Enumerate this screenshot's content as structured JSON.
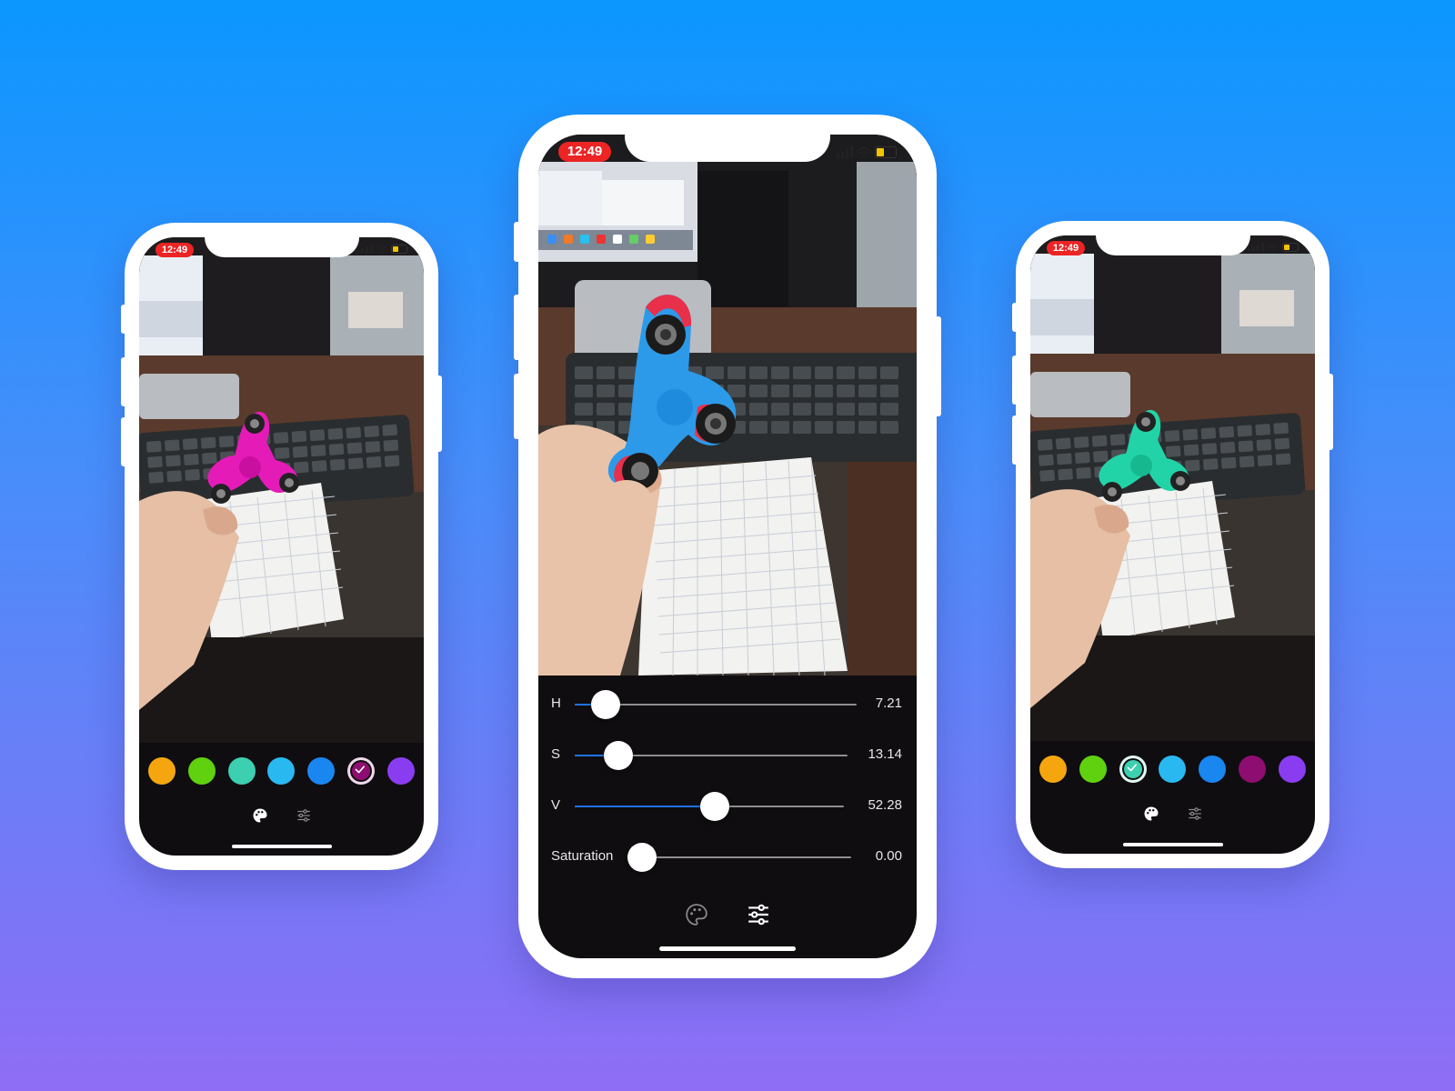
{
  "background": {
    "top_color": "#0b97ff",
    "bottom_color": "#8f6df5"
  },
  "phones": {
    "left": {
      "status_time": "12:49",
      "spinner_color": "#e51bb8",
      "swatches": [
        {
          "color": "#f5a60f",
          "selected": false
        },
        {
          "color": "#5fd10f",
          "selected": false
        },
        {
          "color": "#3ccfb0",
          "selected": false
        },
        {
          "color": "#2ab8f0",
          "selected": false
        },
        {
          "color": "#1a86f0",
          "selected": false
        },
        {
          "color": "#8e0d70",
          "selected": true
        },
        {
          "color": "#8a3df0",
          "selected": false
        }
      ],
      "tabs": {
        "active": "palette",
        "items": [
          "palette-icon",
          "sliders-icon"
        ]
      }
    },
    "center": {
      "status_time": "12:49",
      "spinner_color": "#2c9ae8",
      "sliders": [
        {
          "label": "H",
          "value_text": "7.21",
          "fraction": 0.11
        },
        {
          "label": "S",
          "value_text": "13.14",
          "fraction": 0.16
        },
        {
          "label": "V",
          "value_text": "52.28",
          "fraction": 0.52
        },
        {
          "label": "Saturation",
          "value_text": "0.00",
          "fraction": 0.0
        }
      ],
      "tabs": {
        "active": "sliders",
        "items": [
          "palette-icon",
          "sliders-icon"
        ]
      }
    },
    "right": {
      "status_time": "12:49",
      "spinner_color": "#22d3a8",
      "swatches": [
        {
          "color": "#f5a60f",
          "selected": false
        },
        {
          "color": "#5fd10f",
          "selected": false
        },
        {
          "color": "#3ccfb0",
          "selected": true
        },
        {
          "color": "#2ab8f0",
          "selected": false
        },
        {
          "color": "#1a86f0",
          "selected": false
        },
        {
          "color": "#8e0d70",
          "selected": false
        },
        {
          "color": "#8a3df0",
          "selected": false
        }
      ],
      "tabs": {
        "active": "palette",
        "items": [
          "palette-icon",
          "sliders-icon"
        ]
      }
    }
  }
}
